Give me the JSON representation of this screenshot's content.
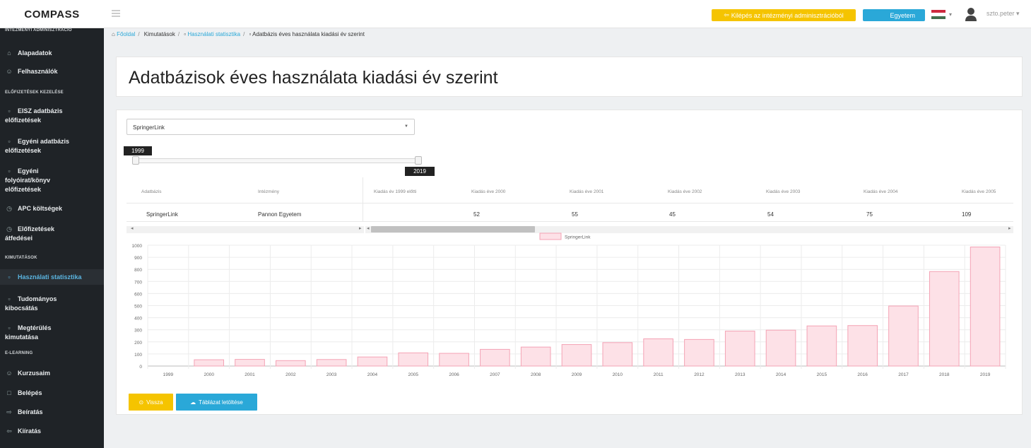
{
  "app": {
    "brand": "COMPASS"
  },
  "topbar": {
    "exit_button": "Kilépés az intézményi adminisztrációból",
    "institution_button": "Egyetem",
    "user_name": "szto.peter"
  },
  "sidebar": {
    "sections": [
      {
        "label": "INTÉZMÉNYI ADMINISZTRÁCIÓ"
      },
      {
        "label": "ELŐFIZETÉSEK KEZELÉSE"
      },
      {
        "label": "KIMUTATÁSOK"
      },
      {
        "label": "E-LEARNING"
      }
    ],
    "items": [
      {
        "label": "Alapadatok",
        "icon": "building-icon"
      },
      {
        "label": "Felhasználók",
        "icon": "users-icon"
      },
      {
        "label": "EISZ adatbázis",
        "label2": "előfizetések",
        "icon": "table-icon"
      },
      {
        "label": "Egyéni adatbázis",
        "label2": "előfizetések",
        "icon": "table-icon"
      },
      {
        "label": "Egyéni",
        "label2": "folyóirat/könyv",
        "label3": "előfizetések",
        "icon": "table-icon"
      },
      {
        "label": "APC költségek",
        "icon": "coins-icon"
      },
      {
        "label": "Előfizetések",
        "label2": "átfedései",
        "icon": "coins-icon"
      },
      {
        "label": "Használati statisztika",
        "icon": "table-icon"
      },
      {
        "label": "Tudományos",
        "label2": "kibocsátás",
        "icon": "table-icon"
      },
      {
        "label": "Megtérülés",
        "label2": "kimutatása",
        "icon": "table-icon"
      },
      {
        "label": "Kurzusaim",
        "icon": "users-icon"
      },
      {
        "label": "Belépés",
        "icon": "square-icon"
      },
      {
        "label": "Beíratás",
        "icon": "arrow-icon"
      },
      {
        "label": "Kiíratás",
        "icon": "arrow-icon"
      }
    ]
  },
  "breadcrumb": [
    {
      "label": "Főoldal"
    },
    {
      "label": "Kimutatások"
    },
    {
      "label": "Használati statisztika"
    },
    {
      "label": "Adatbázis éves használata kiadási év szerint"
    }
  ],
  "page": {
    "title": "Adatbázisok éves használata kiadási év szerint",
    "database_select": "SpringerLink",
    "slider": {
      "min_label": "1999",
      "max_label": "2019",
      "range_low": 1999,
      "range_high": 2019
    }
  },
  "table": {
    "headers": [
      "Adatbázis",
      "Intézmény",
      "Kiadás év 1999 előtti",
      "Kiadás éve 2000",
      "Kiadás éve 2001",
      "Kiadás éve 2002",
      "Kiadás éve 2003",
      "Kiadás éve 2004",
      "Kiadás éve 2005"
    ],
    "row": [
      "SpringerLink",
      "Pannon Egyetem",
      "",
      "52",
      "55",
      "45",
      "54",
      "75",
      "109"
    ]
  },
  "chart_data": {
    "type": "bar",
    "categories": [
      "1999",
      "2000",
      "2001",
      "2002",
      "2003",
      "2004",
      "2005",
      "2006",
      "2007",
      "2008",
      "2009",
      "2010",
      "2011",
      "2012",
      "2013",
      "2014",
      "2015",
      "2016",
      "2017",
      "2018",
      "2019"
    ],
    "series": [
      {
        "name": "SpringerLink",
        "values": [
          0,
          52,
          55,
          45,
          54,
          75,
          109,
          105,
          138,
          157,
          178,
          194,
          225,
          220,
          289,
          297,
          332,
          335,
          497,
          782,
          985
        ]
      }
    ],
    "ylim": [
      0,
      1000
    ],
    "yticks": [
      0,
      100,
      200,
      300,
      400,
      500,
      600,
      700,
      800,
      900,
      1000
    ],
    "grid": true,
    "legend_position": "top",
    "bar_fill": "#fde1e7",
    "bar_stroke": "#f4a3b5"
  },
  "buttons": {
    "back": "Vissza",
    "download": "Táblázat letöltése"
  },
  "colors": {
    "sidebar_bg": "#1f2327",
    "accent_blue": "#2aa8d8",
    "accent_yellow": "#f5c400"
  }
}
